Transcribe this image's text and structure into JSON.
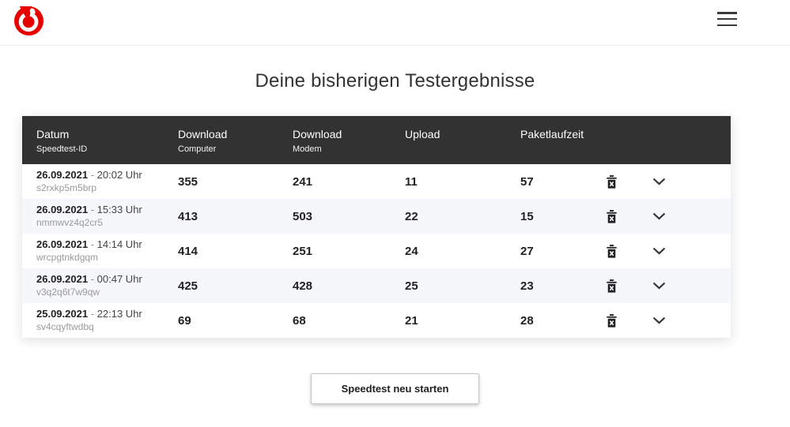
{
  "header": {
    "logo": "vodafone-speechmark",
    "menu_icon": "hamburger-menu"
  },
  "page": {
    "title": "Deine bisherigen Testergebnisse"
  },
  "table": {
    "columns": [
      {
        "label": "Datum",
        "sublabel": "Speedtest-ID"
      },
      {
        "label": "Download",
        "sublabel": "Computer"
      },
      {
        "label": "Download",
        "sublabel": "Modem"
      },
      {
        "label": "Upload",
        "sublabel": ""
      },
      {
        "label": "Paketlaufzeit",
        "sublabel": ""
      }
    ],
    "date_time_separator": "-",
    "rows": [
      {
        "date": "26.09.2021",
        "time": "20:02 Uhr",
        "id": "s2rxkp5m5brp",
        "download_computer": "355",
        "download_modem": "241",
        "upload": "11",
        "paketlaufzeit": "57"
      },
      {
        "date": "26.09.2021",
        "time": "15:33 Uhr",
        "id": "nmmwvz4q2cr5",
        "download_computer": "413",
        "download_modem": "503",
        "upload": "22",
        "paketlaufzeit": "15"
      },
      {
        "date": "26.09.2021",
        "time": "14:14 Uhr",
        "id": "wrcpgtnkdgqm",
        "download_computer": "414",
        "download_modem": "251",
        "upload": "24",
        "paketlaufzeit": "27"
      },
      {
        "date": "26.09.2021",
        "time": "00:47 Uhr",
        "id": "v3q2q6t7w9qw",
        "download_computer": "425",
        "download_modem": "428",
        "upload": "25",
        "paketlaufzeit": "23"
      },
      {
        "date": "25.09.2021",
        "time": "22:13 Uhr",
        "id": "sv4cqyftwdbq",
        "download_computer": "69",
        "download_modem": "68",
        "upload": "21",
        "paketlaufzeit": "28"
      }
    ],
    "row_icons": {
      "delete": "trash-delete-icon",
      "expand": "chevron-down-icon"
    }
  },
  "actions": {
    "restart_label": "Speedtest neu starten"
  },
  "colors": {
    "brand_red": "#e60000",
    "table_header_bg": "#323232",
    "row_alt_bg": "#f6f7fa"
  }
}
